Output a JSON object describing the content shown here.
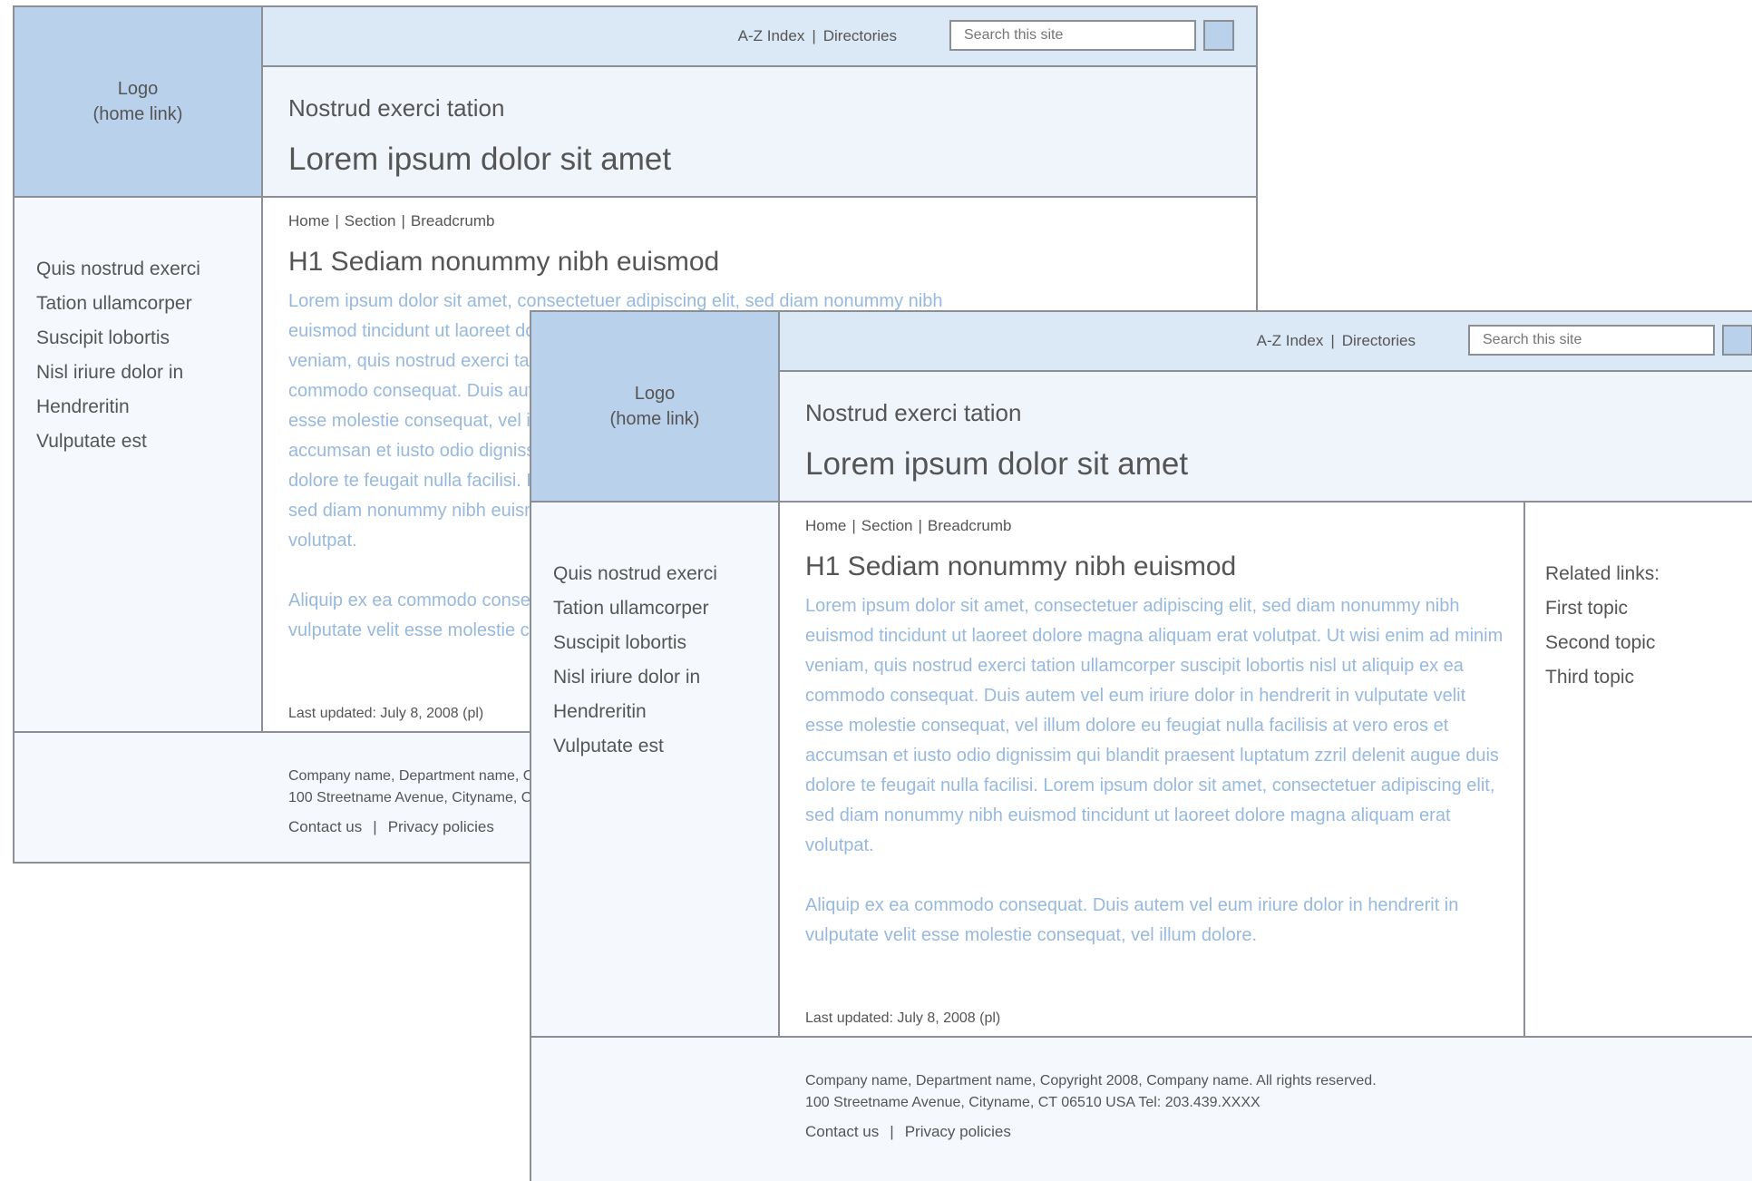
{
  "logo": {
    "line1": "Logo",
    "line2": "(home link)"
  },
  "utility_nav": {
    "az_index": "A-Z Index",
    "separator": "|",
    "directories": "Directories"
  },
  "search": {
    "placeholder": "Search this site"
  },
  "header": {
    "subtitle": "Nostrud exerci tation",
    "title": "Lorem ipsum dolor sit amet"
  },
  "left_nav": {
    "items": [
      "Quis nostrud exerci",
      "Tation ullamcorper",
      "Suscipit lobortis",
      "Nisl iriure dolor in",
      "Hendreritin",
      "Vulputate est"
    ]
  },
  "breadcrumb": {
    "home": "Home",
    "section": "Section",
    "current": "Breadcrumb",
    "separator": "|"
  },
  "main": {
    "h1": "H1 Sediam nonummy nibh euismod",
    "paragraph1": "Lorem ipsum dolor sit amet, consectetuer adipiscing elit, sed diam nonummy nibh euismod tincidunt ut laoreet dolore magna aliquam erat volutpat. Ut wisi enim ad minim veniam, quis nostrud exerci tation ullamcorper suscipit lobortis nisl ut aliquip ex ea commodo consequat. Duis autem vel eum iriure dolor in hendrerit in vulputate velit esse molestie consequat, vel illum dolore eu feugiat nulla facilisis at vero eros et accumsan et iusto odio dignissim qui blandit praesent luptatum zzril delenit augue duis dolore te feugait nulla facilisi. Lorem ipsum dolor sit amet, consectetuer adipiscing elit, sed diam nonummy nibh euismod tincidunt ut laoreet dolore magna aliquam erat volutpat.",
    "paragraph2": "Aliquip ex ea commodo consequat. Duis autem vel eum iriure dolor in hendrerit in vulputate velit esse molestie consequat, vel illum dolore.",
    "last_updated": "Last updated: July 8, 2008 (pl)"
  },
  "related": {
    "heading": "Related links:",
    "items": [
      "First topic",
      "Second topic",
      "Third topic"
    ]
  },
  "footer": {
    "line1": "Company name, Department name, Copyright 2008, Company name. All rights reserved.",
    "line2": "100 Streetname Avenue, Cityname, CT 06510  USA   Tel: 203.439.XXXX",
    "contact": "Contact us",
    "separator": "|",
    "privacy": "Privacy policies"
  },
  "colors": {
    "logo_bg": "#b9d1ea",
    "header_bg": "#dbe8f5",
    "body_text": "#97b9dd",
    "border": "#8a8f96"
  }
}
